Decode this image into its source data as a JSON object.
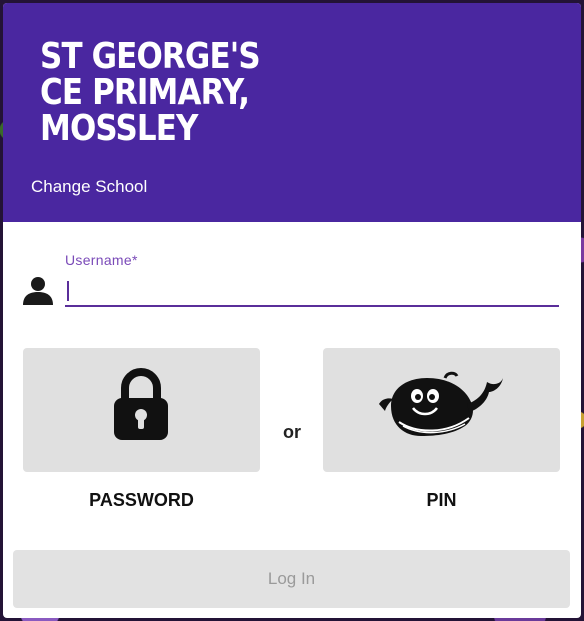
{
  "school": {
    "name": "ST GEORGE'S CE PRIMARY, MOSSLEY",
    "change_label": "Change School"
  },
  "username": {
    "label": "Username*",
    "value": "",
    "icon": "person-icon"
  },
  "login_options": {
    "password_label": "PASSWORD",
    "password_icon": "padlock-icon",
    "separator": "or",
    "pin_label": "PIN",
    "pin_icon": "whale-icon"
  },
  "login_button": {
    "label": "Log In"
  },
  "colors": {
    "header": "#4a27a0",
    "accent": "#5a2e9a",
    "label": "#7a4ab8",
    "tile": "#e0e0e0",
    "button_disabled": "#e2e2e2",
    "button_text_disabled": "#9a9a9a"
  }
}
